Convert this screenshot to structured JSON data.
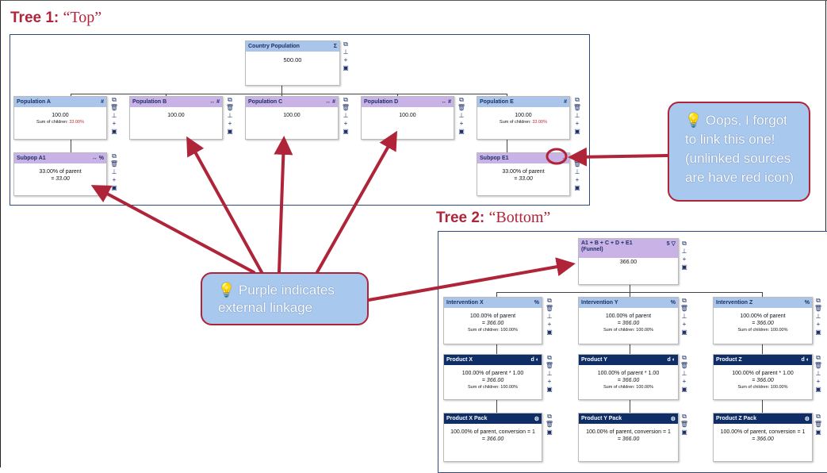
{
  "tree1": {
    "title_bold": "Tree 1:",
    "title_name": "“Top”",
    "root": {
      "title": "Country Population",
      "icon": "Σ",
      "lines": [
        "500.00"
      ]
    },
    "level1": [
      {
        "title": "Population A",
        "icon": "#",
        "value": "100.00",
        "sum_label": "Sum of children:",
        "sum_value": "33.00%"
      },
      {
        "title": "Population B",
        "icon": "↔ #",
        "value": "100.00"
      },
      {
        "title": "Population C",
        "icon": "↔ #",
        "value": "100.00"
      },
      {
        "title": "Population D",
        "icon": "↔ #",
        "value": "100.00"
      },
      {
        "title": "Population E",
        "icon": "#",
        "value": "100.00",
        "sum_label": "Sum of children:",
        "sum_value": "33.00%"
      }
    ],
    "level2": [
      {
        "title": "Subpop A1",
        "icon": "↔ %",
        "line1": "33.00% of parent",
        "line2": "= 33.00"
      },
      {
        "title": "Subpop E1",
        "icon": "↔",
        "line1": "33.00% of parent",
        "line2": "= 33.00"
      }
    ]
  },
  "tree2": {
    "title_bold": "Tree 2:",
    "title_name": "“Bottom”",
    "root": {
      "title": "A1 + B + C + D + E1",
      "subtitle": "(Funnel)",
      "icon": "5 ▽",
      "value": "366.00"
    },
    "interventions": [
      {
        "title": "Intervention X",
        "icon": "%",
        "line1": "100.00% of parent",
        "line2": "= 366.00",
        "line3": "Sum of children: 100.00%"
      },
      {
        "title": "Intervention Y",
        "icon": "%",
        "line1": "100.00% of parent",
        "line2": "= 366.00",
        "line3": "Sum of children: 100.00%"
      },
      {
        "title": "Intervention Z",
        "icon": "%",
        "line1": "100.00% of parent",
        "line2": "= 366.00",
        "line3": "Sum of children: 100.00%"
      }
    ],
    "products": [
      {
        "title": "Product X",
        "icon": "d ◐",
        "line1": "100.00% of parent * 1.00",
        "line2": "= 366.00",
        "line3": "Sum of children: 100.00%"
      },
      {
        "title": "Product Y",
        "icon": "d ◐",
        "line1": "100.00% of parent * 1.00",
        "line2": "= 366.00",
        "line3": "Sum of children: 100.00%"
      },
      {
        "title": "Product Z",
        "icon": "d ◐",
        "line1": "100.00% of parent * 1.00",
        "line2": "= 366.00",
        "line3": "Sum of children: 100.00%"
      }
    ],
    "packs": [
      {
        "title": "Product X Pack",
        "icon": "⚙",
        "line1": "100.00% of parent, conversion = 1",
        "line2": "= 366.00"
      },
      {
        "title": "Product Y Pack",
        "icon": "⚙",
        "line1": "100.00% of parent, conversion = 1",
        "line2": "= 366.00"
      },
      {
        "title": "Product Z Pack",
        "icon": "⚙",
        "line1": "100.00% of parent, conversion = 1",
        "line2": "= 366.00"
      }
    ]
  },
  "side_icons": [
    "⧉",
    "🗑",
    "⊥",
    "+",
    "▣"
  ],
  "callouts": {
    "forgot": {
      "line1": "Oops, I forgot",
      "line2": "to link this one!",
      "line3": "(unlinked sources",
      "line4": "are have red icon)"
    },
    "purple": {
      "line1": "Purple indicates",
      "line2": "external linkage"
    }
  },
  "colors": {
    "accent": "#b0243a",
    "blue_header": "#a9c6ea",
    "purple_header": "#c9b2e6",
    "dark_header": "#0f2d66",
    "callout_fill": "#a8c8ee"
  }
}
